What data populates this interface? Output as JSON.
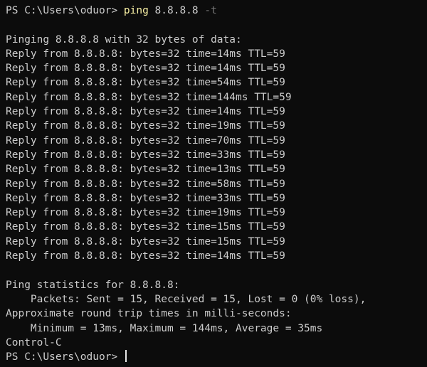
{
  "terminal": {
    "prompt": "PS C:\\Users\\oduor> ",
    "command": {
      "name": "ping",
      "target": "8.8.8.8",
      "flag": "-t"
    },
    "header": "Pinging 8.8.8.8 with 32 bytes of data:",
    "replies": [
      "Reply from 8.8.8.8: bytes=32 time=14ms TTL=59",
      "Reply from 8.8.8.8: bytes=32 time=14ms TTL=59",
      "Reply from 8.8.8.8: bytes=32 time=54ms TTL=59",
      "Reply from 8.8.8.8: bytes=32 time=144ms TTL=59",
      "Reply from 8.8.8.8: bytes=32 time=14ms TTL=59",
      "Reply from 8.8.8.8: bytes=32 time=19ms TTL=59",
      "Reply from 8.8.8.8: bytes=32 time=70ms TTL=59",
      "Reply from 8.8.8.8: bytes=32 time=33ms TTL=59",
      "Reply from 8.8.8.8: bytes=32 time=13ms TTL=59",
      "Reply from 8.8.8.8: bytes=32 time=58ms TTL=59",
      "Reply from 8.8.8.8: bytes=32 time=33ms TTL=59",
      "Reply from 8.8.8.8: bytes=32 time=19ms TTL=59",
      "Reply from 8.8.8.8: bytes=32 time=15ms TTL=59",
      "Reply from 8.8.8.8: bytes=32 time=15ms TTL=59",
      "Reply from 8.8.8.8: bytes=32 time=14ms TTL=59"
    ],
    "stats_header": "Ping statistics for 8.8.8.8:",
    "packets": "    Packets: Sent = 15, Received = 15, Lost = 0 (0% loss),",
    "rtt_header": "Approximate round trip times in milli-seconds:",
    "rtt": "    Minimum = 13ms, Maximum = 144ms, Average = 35ms",
    "interrupt": "Control-C",
    "final_prompt": "PS C:\\Users\\oduor> "
  },
  "colors": {
    "background": "#0c0c0c",
    "text": "#cccccc",
    "command": "#f9f1a5",
    "flag": "#767676"
  }
}
